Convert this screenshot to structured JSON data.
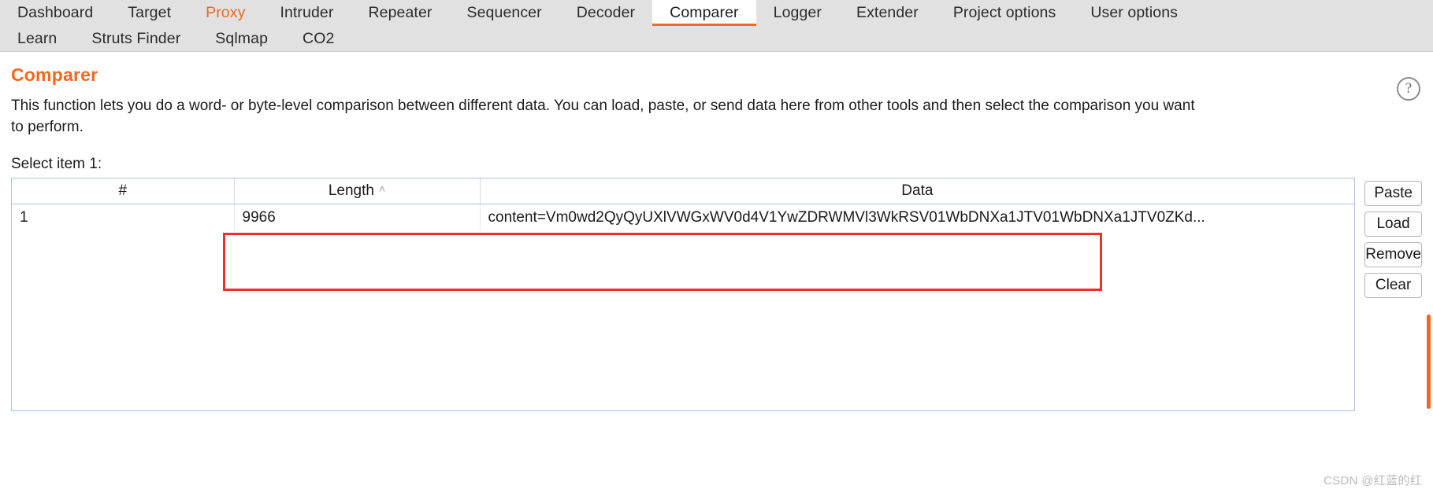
{
  "tabs": {
    "row1": [
      {
        "label": "Dashboard",
        "state": "normal"
      },
      {
        "label": "Target",
        "state": "normal"
      },
      {
        "label": "Proxy",
        "state": "accent"
      },
      {
        "label": "Intruder",
        "state": "normal"
      },
      {
        "label": "Repeater",
        "state": "normal"
      },
      {
        "label": "Sequencer",
        "state": "normal"
      },
      {
        "label": "Decoder",
        "state": "normal"
      },
      {
        "label": "Comparer",
        "state": "active"
      },
      {
        "label": "Logger",
        "state": "normal"
      },
      {
        "label": "Extender",
        "state": "normal"
      },
      {
        "label": "Project options",
        "state": "normal"
      },
      {
        "label": "User options",
        "state": "normal"
      }
    ],
    "row2": [
      {
        "label": "Learn",
        "state": "normal"
      },
      {
        "label": "Struts Finder",
        "state": "normal"
      },
      {
        "label": "Sqlmap",
        "state": "normal"
      },
      {
        "label": "CO2",
        "state": "normal"
      }
    ]
  },
  "header": {
    "title": "Comparer",
    "description": "This function lets you do a word- or byte-level comparison between different data. You can load, paste, or send data here from other tools and then select the comparison you want to perform.",
    "help_icon": "question-mark-icon",
    "help_glyph": "?"
  },
  "section": {
    "select_label": "Select item 1:"
  },
  "table": {
    "columns": [
      {
        "key": "num",
        "label": "#",
        "sort": ""
      },
      {
        "key": "length",
        "label": "Length",
        "sort": "ascending"
      },
      {
        "key": "data",
        "label": "Data",
        "sort": ""
      }
    ],
    "sort_caret_glyph": "˄",
    "rows": [
      {
        "num": "1",
        "length": "9966",
        "data": "content=Vm0wd2QyQyUXlVWGxWV0d4V1YwZDRWMVl3WkRSV01WbDNXa1JTV01WbDNXa1JTV0ZKd..."
      }
    ]
  },
  "buttons": [
    {
      "label": "Paste",
      "name": "paste-button"
    },
    {
      "label": "Load",
      "name": "load-button"
    },
    {
      "label": "Remove",
      "name": "remove-button"
    },
    {
      "label": "Clear",
      "name": "clear-button"
    }
  ],
  "watermark": "CSDN @红蓝的红",
  "colors": {
    "accent": "#f26721",
    "annotation": "#ef3124",
    "tabbar_bg": "#e1e1e1",
    "table_border": "#a9c3de"
  }
}
